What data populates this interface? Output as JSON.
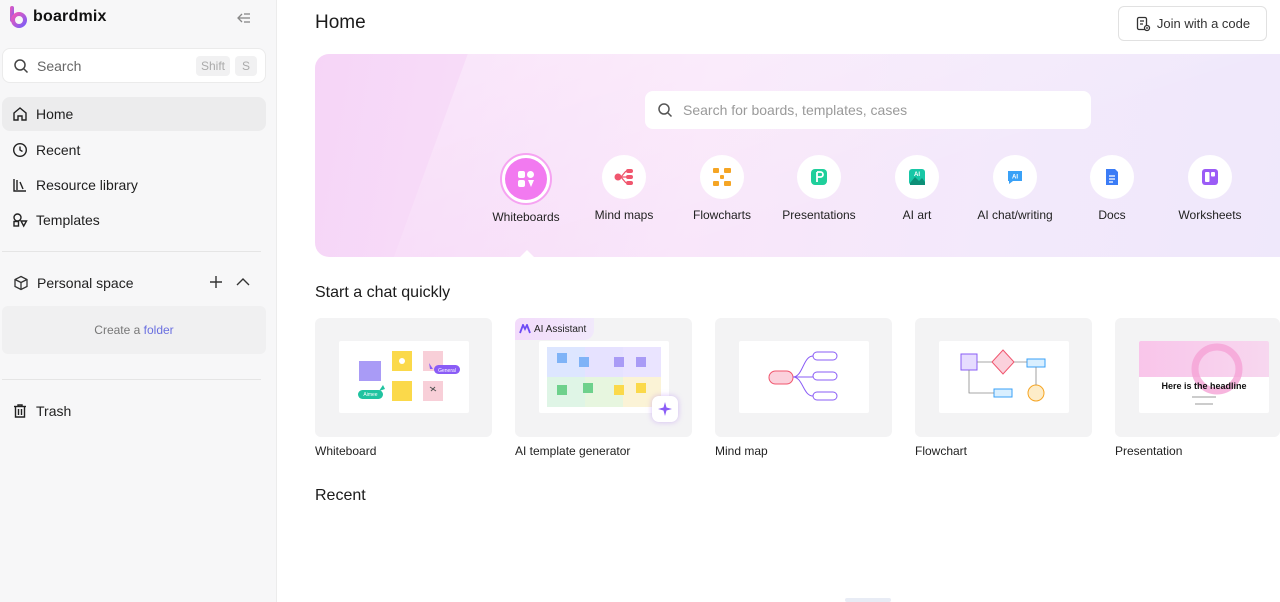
{
  "brand": {
    "name": "boardmix"
  },
  "sidebar": {
    "search": {
      "label": "Search",
      "shortcut_shift": "Shift",
      "shortcut_key": "S"
    },
    "nav": [
      {
        "label": "Home",
        "icon": "home-icon",
        "active": true
      },
      {
        "label": "Recent",
        "icon": "clock-icon"
      },
      {
        "label": "Resource library",
        "icon": "library-icon"
      },
      {
        "label": "Templates",
        "icon": "templates-icon"
      }
    ],
    "personal_space": {
      "label": "Personal space",
      "create_prefix": "Create a ",
      "create_link": "folder"
    },
    "trash": {
      "label": "Trash"
    }
  },
  "main": {
    "title": "Home",
    "join_button": "Join with a code",
    "hero_search_placeholder": "Search for boards, templates, cases",
    "categories": [
      {
        "label": "Whiteboards",
        "icon": "whiteboard-icon",
        "color": "#f27af0"
      },
      {
        "label": "Mind maps",
        "icon": "mindmap-icon",
        "color": "#f0566e"
      },
      {
        "label": "Flowcharts",
        "icon": "flowchart-icon",
        "color": "#f5a524"
      },
      {
        "label": "Presentations",
        "icon": "presentation-icon",
        "color": "#1fcf9b"
      },
      {
        "label": "AI art",
        "icon": "ai-art-icon",
        "color": "#18c7a6"
      },
      {
        "label": "AI chat/writing",
        "icon": "ai-chat-icon",
        "color": "#3aa1f7"
      },
      {
        "label": "Docs",
        "icon": "docs-icon",
        "color": "#3b7cf6"
      },
      {
        "label": "Worksheets",
        "icon": "worksheet-icon",
        "color": "#9b5cf6"
      }
    ],
    "quick_section": "Start a chat quickly",
    "quick_cards": [
      {
        "label": "Whiteboard"
      },
      {
        "label": "AI template generator",
        "badge": "AI Assistant"
      },
      {
        "label": "Mind map"
      },
      {
        "label": "Flowchart"
      },
      {
        "label": "Presentation",
        "headline": "Here is the headline"
      }
    ],
    "whiteboard_thumb": {
      "tag_general": "General",
      "tag_aimee": "Aimee"
    },
    "recent_section": "Recent"
  }
}
